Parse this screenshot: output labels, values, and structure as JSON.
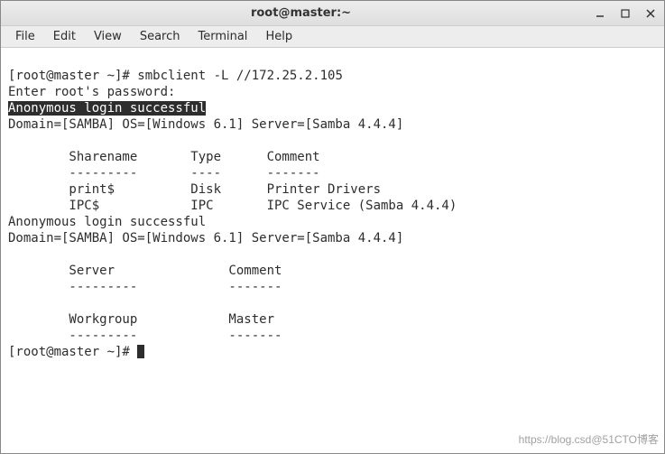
{
  "window": {
    "title": "root@master:~"
  },
  "menubar": {
    "items": [
      "File",
      "Edit",
      "View",
      "Search",
      "Terminal",
      "Help"
    ]
  },
  "terminal": {
    "prompt1_open": "[root@master ~]# ",
    "prompt1_cmd": "smbclient -L //172.25.2.105",
    "line2": "Enter root's password:",
    "line3_hl": "Anonymous login successful",
    "line4": "Domain=[SAMBA] OS=[Windows 6.1] Server=[Samba 4.4.4]",
    "blank": "",
    "shares_header": "        Sharename       Type      Comment",
    "shares_divider": "        ---------       ----      -------",
    "share_print": "        print$          Disk      Printer Drivers",
    "share_ipc": "        IPC$            IPC       IPC Service (Samba 4.4.4)",
    "line_anon2": "Anonymous login successful",
    "line_domain2": "Domain=[SAMBA] OS=[Windows 6.1] Server=[Samba 4.4.4]",
    "server_header": "        Server               Comment",
    "server_divider": "        ---------            -------",
    "workgroup_header": "        Workgroup            Master",
    "workgroup_divider": "        ---------            -------",
    "prompt2_open": "[root@master ~]# "
  },
  "watermark": "https://blog.csd@51CTO博客"
}
